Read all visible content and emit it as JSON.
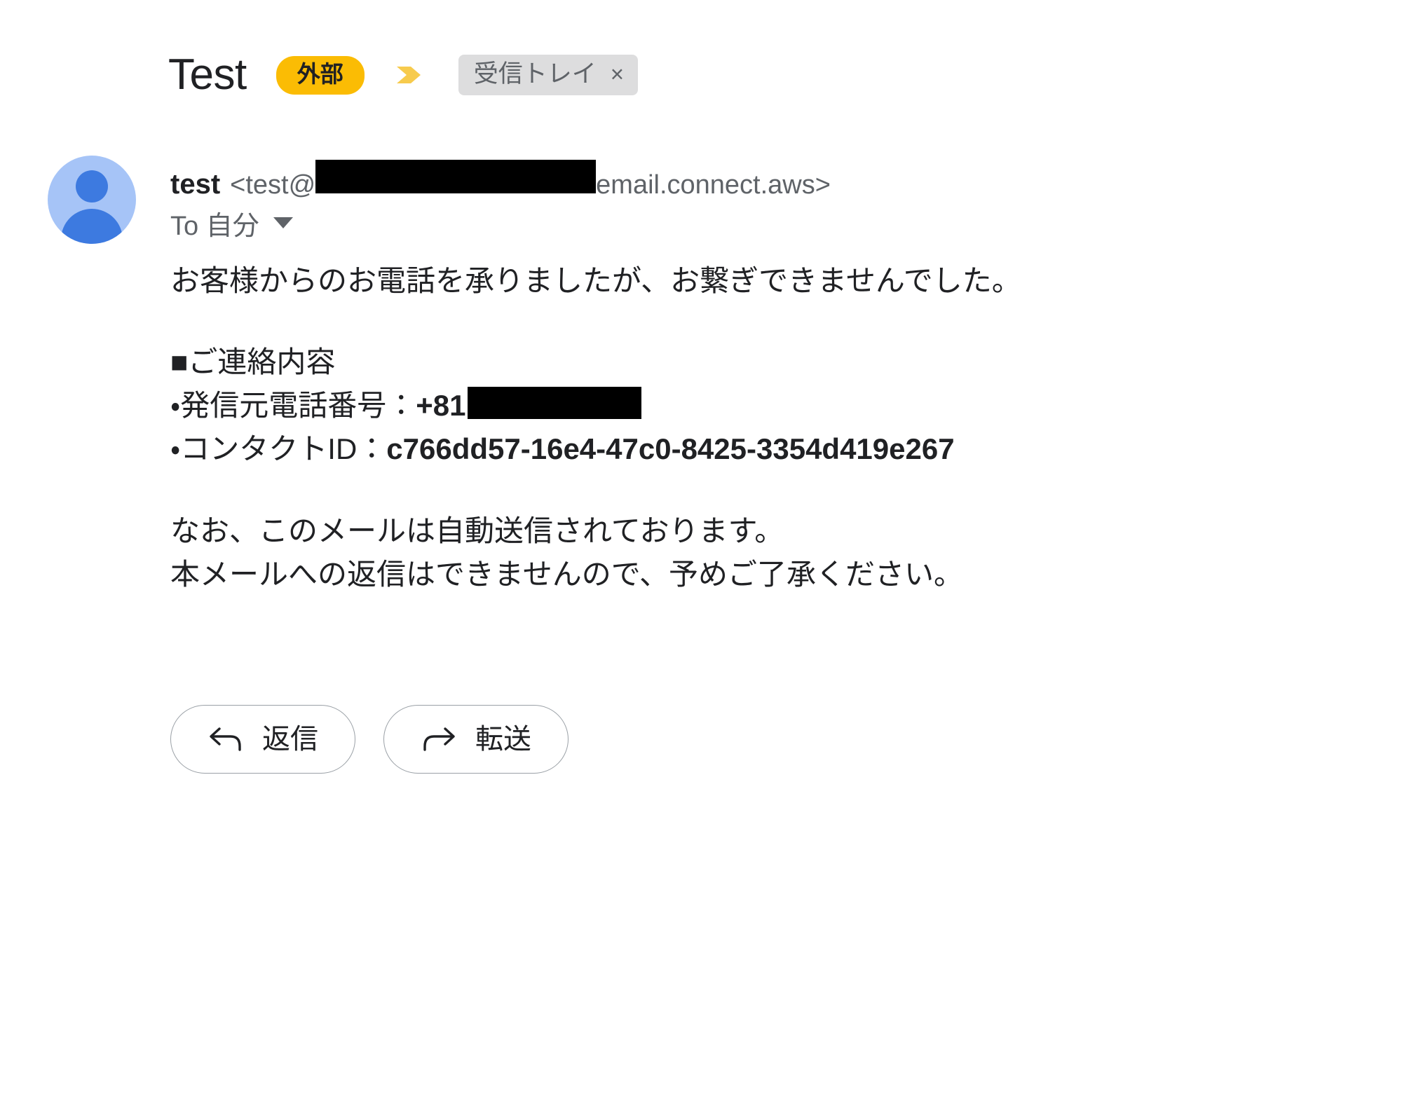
{
  "message": {
    "subject": "Test",
    "external_badge": "外部",
    "label_chip": {
      "text": "受信トレイ",
      "close": "×"
    },
    "sender": {
      "name": "test",
      "address_prefix": "<test@",
      "address_suffix": "email.connect.aws>",
      "redacted": true
    },
    "recipient": {
      "to_label": "To 自分"
    },
    "body": {
      "line1": "お客様からのお電話を承りましたが、お繋ぎできませんでした。",
      "section_heading": "■ご連絡内容",
      "phone_label": "・発信元電話番号：",
      "phone_prefix": "+81",
      "contact_id_label": "・コンタクトID：",
      "contact_id_value": "c766dd57-16e4-47c0-8425-3354d419e267",
      "note_line1": "なお、このメールは自動送信されております。",
      "note_line2": "本メールへの返信はできませんので、予めご了承ください。"
    },
    "actions": {
      "reply_label": "返信",
      "forward_label": "転送"
    }
  },
  "colors": {
    "external_badge_bg": "#fbbc04",
    "chevron": "#f7cb4d",
    "label_chip_bg": "#ddddde",
    "label_chip_text": "#5f6368",
    "avatar_bg": "#a6c4f7",
    "avatar_figure": "#3d7ae0",
    "text_primary": "#202124",
    "text_secondary": "#5f6368",
    "button_border": "#9aa0a6",
    "redaction": "#000000"
  },
  "icons": {
    "reply": "reply-arrow-icon",
    "forward": "forward-arrow-icon",
    "chevron": "chevron-right-marker-icon",
    "caret": "chevron-down-icon"
  }
}
